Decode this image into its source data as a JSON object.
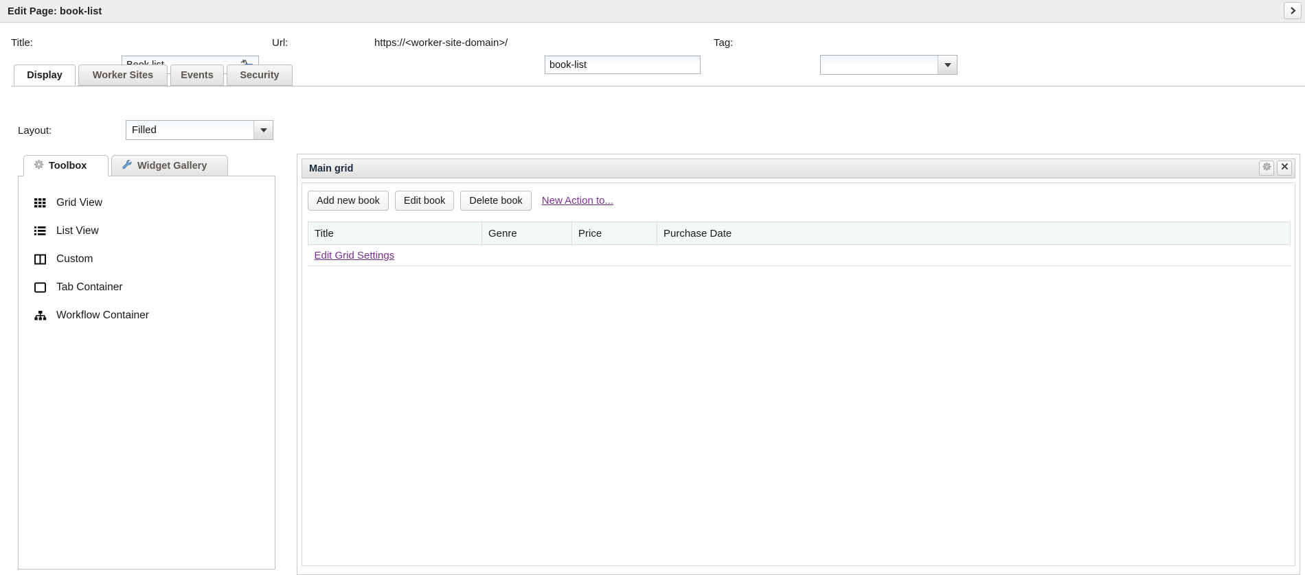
{
  "window": {
    "title": "Edit Page: book-list",
    "close_icon": "chevron-right-icon"
  },
  "form": {
    "title_label": "Title:",
    "title_value": "Book list",
    "title_icon": "translate-icon",
    "url_label": "Url:",
    "url_prefix": "https://<worker-site-domain>/",
    "url_value": "book-list",
    "tag_label": "Tag:",
    "tag_value": "",
    "tag_arrow_icon": "chevron-down-icon"
  },
  "tabs": [
    {
      "label": "Display",
      "active": true
    },
    {
      "label": "Worker Sites",
      "active": false
    },
    {
      "label": "Events",
      "active": false
    },
    {
      "label": "Security",
      "active": false
    }
  ],
  "layout": {
    "label": "Layout:",
    "value": "Filled",
    "arrow_icon": "chevron-down-icon"
  },
  "toolbox": {
    "tabs": [
      {
        "label": "Toolbox",
        "icon": "gear-icon",
        "active": true
      },
      {
        "label": "Widget Gallery",
        "icon": "wrench-icon",
        "active": false
      }
    ],
    "items": [
      {
        "label": "Grid View",
        "icon": "grid-view-icon"
      },
      {
        "label": "List View",
        "icon": "list-view-icon"
      },
      {
        "label": "Custom",
        "icon": "custom-columns-icon"
      },
      {
        "label": "Tab Container",
        "icon": "tab-container-icon"
      },
      {
        "label": "Workflow Container",
        "icon": "workflow-container-icon"
      }
    ]
  },
  "main_panel": {
    "title": "Main grid",
    "settings_icon": "gear-icon",
    "close_icon": "close-icon",
    "actions": [
      {
        "label": "Add new book"
      },
      {
        "label": "Edit book"
      },
      {
        "label": "Delete book"
      }
    ],
    "new_action_link": "New Action to...",
    "columns": [
      "Title",
      "Genre",
      "Price",
      "Purchase Date"
    ],
    "rows": [],
    "edit_grid_link": "Edit Grid Settings"
  },
  "colors": {
    "link": "#7a2f8f",
    "header_bg": "#eeeeee",
    "table_header_bg": "#f3f8f8"
  }
}
